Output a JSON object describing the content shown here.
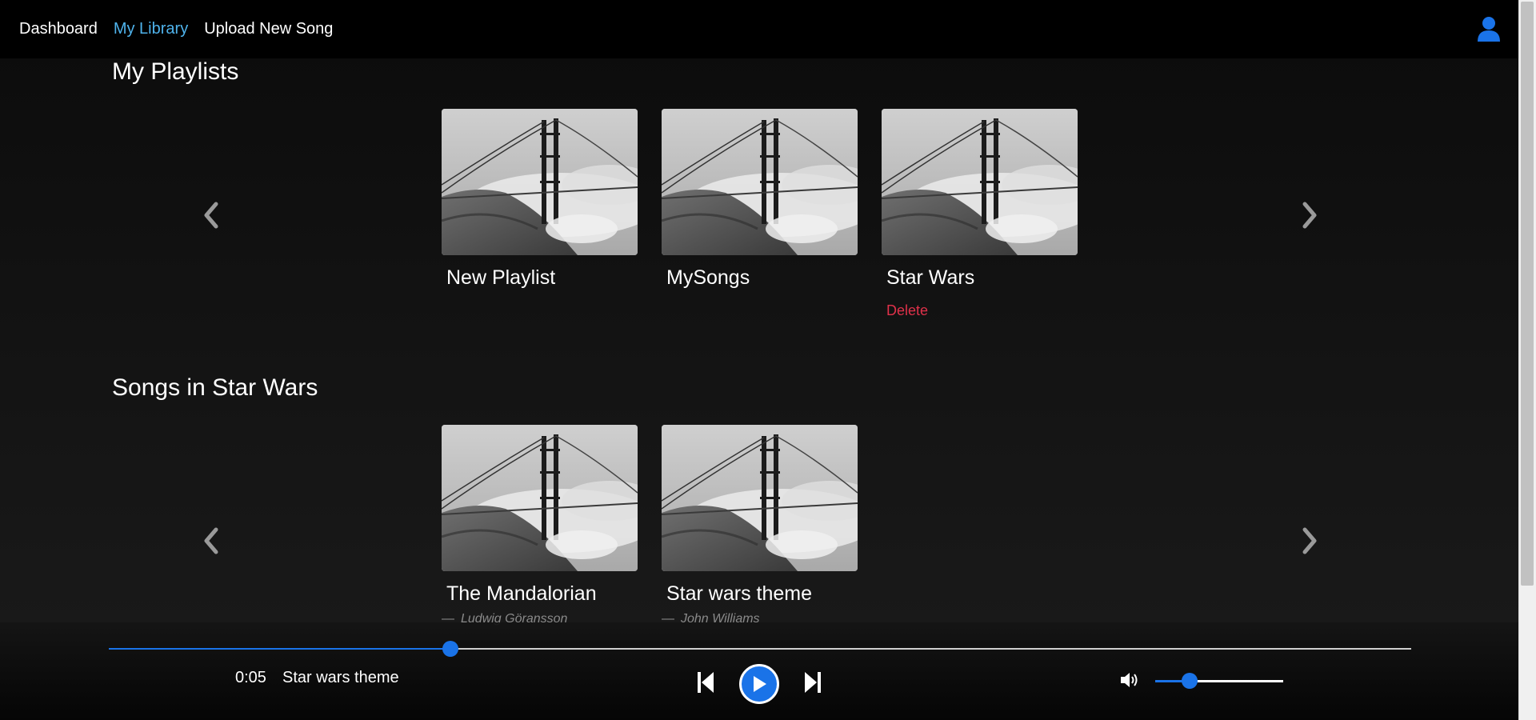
{
  "nav": {
    "links": [
      {
        "label": "Dashboard",
        "active": false
      },
      {
        "label": "My Library",
        "active": true
      },
      {
        "label": "Upload New Song",
        "active": false
      }
    ],
    "user_icon": "user-icon"
  },
  "colors": {
    "accent": "#1a73e8",
    "active_link": "#4fb3ec",
    "delete": "#e0314a",
    "background": "#121212"
  },
  "playlists": {
    "title": "My Playlists",
    "items": [
      {
        "title": "New Playlist"
      },
      {
        "title": "MySongs"
      },
      {
        "title": "Star Wars",
        "action": "Delete"
      }
    ]
  },
  "songs": {
    "title": "Songs in Star Wars",
    "items": [
      {
        "title": "The Mandalorian",
        "artist": "Ludwig Göransson"
      },
      {
        "title": "Star wars theme",
        "artist": "John Williams"
      }
    ]
  },
  "player": {
    "time": "0:05",
    "now_playing": "Star wars theme",
    "progress": 0.262,
    "volume": 0.27
  }
}
